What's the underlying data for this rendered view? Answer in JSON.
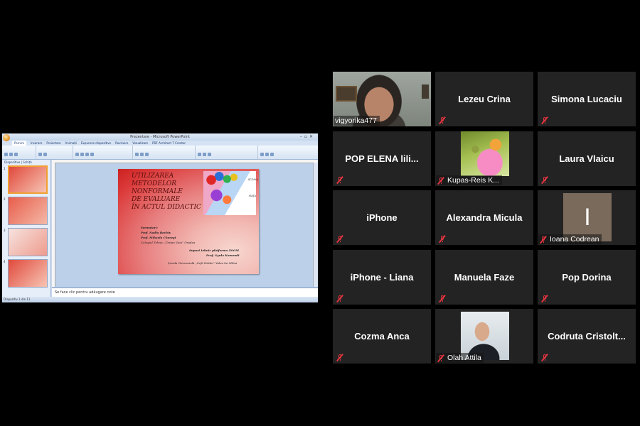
{
  "powerpoint": {
    "window_title": "Prezentare - Microsoft PowerPoint",
    "ribbon_tabs": [
      "Pornire",
      "Inserare",
      "Proiectare",
      "Animații",
      "Expunere diapozitive",
      "Revizuire",
      "Vizualizare",
      "PDF Architect 7 Creator"
    ],
    "pane_tabs": "Diapozitive | Schiță",
    "notes_placeholder": "Se face clic pentru adăugare note",
    "status_text": "Diapozitiv 1 din 11",
    "slide": {
      "title": "Utilizarea\nmetodelor\nnonformale\nde evaluare\nîn actul didactic",
      "photo_word_1": "ȘCOALA",
      "photo_word_2": "VIAȚA",
      "formatori_label": "Formatori:",
      "trainer_1": "Prof. Nadia Bochiș",
      "trainer_2": "Prof. Mihaela Cheregi",
      "school": "Colegiul Tehnic „Traian Vuia” Oradea",
      "support_label": "Suport tehnic platforma ZOOM",
      "support_name": "Prof. Gyula Komondi",
      "host_school": "Școala Gimnazială „Szfő Zoltán” Valea lui Mihai"
    },
    "thumbnail_numbers": [
      "1",
      "2",
      "3",
      "4"
    ]
  },
  "participants": [
    {
      "name": "vigyorika477",
      "display": "video",
      "muted": false
    },
    {
      "name": "Lezeu Crina",
      "display": "name",
      "muted": true
    },
    {
      "name": "Simona Lucaciu",
      "display": "name",
      "muted": true
    },
    {
      "name": "POP ELENA    lili...",
      "display": "name",
      "muted": true
    },
    {
      "name": "Kupas-Reis K...",
      "display": "picture",
      "muted": true
    },
    {
      "name": "Laura Vlaicu",
      "display": "name",
      "muted": true
    },
    {
      "name": "iPhone",
      "display": "name",
      "muted": true
    },
    {
      "name": "Alexandra Micula",
      "display": "name",
      "muted": true
    },
    {
      "name": "Ioana Codrean",
      "display": "picture",
      "muted": true,
      "picture_letter": "I"
    },
    {
      "name": "iPhone - Liana",
      "display": "name",
      "muted": true
    },
    {
      "name": "Manuela Faze",
      "display": "name",
      "muted": true
    },
    {
      "name": "Pop Dorina",
      "display": "name",
      "muted": true
    },
    {
      "name": "Cozma Anca",
      "display": "name",
      "muted": true
    },
    {
      "name": "Olah Attila",
      "display": "picture",
      "muted": true
    },
    {
      "name": "Codruta  Cristolt...",
      "display": "name",
      "muted": true
    }
  ],
  "colors": {
    "background": "#000000",
    "tile": "#232323",
    "mute_icon": "#e0343f"
  }
}
